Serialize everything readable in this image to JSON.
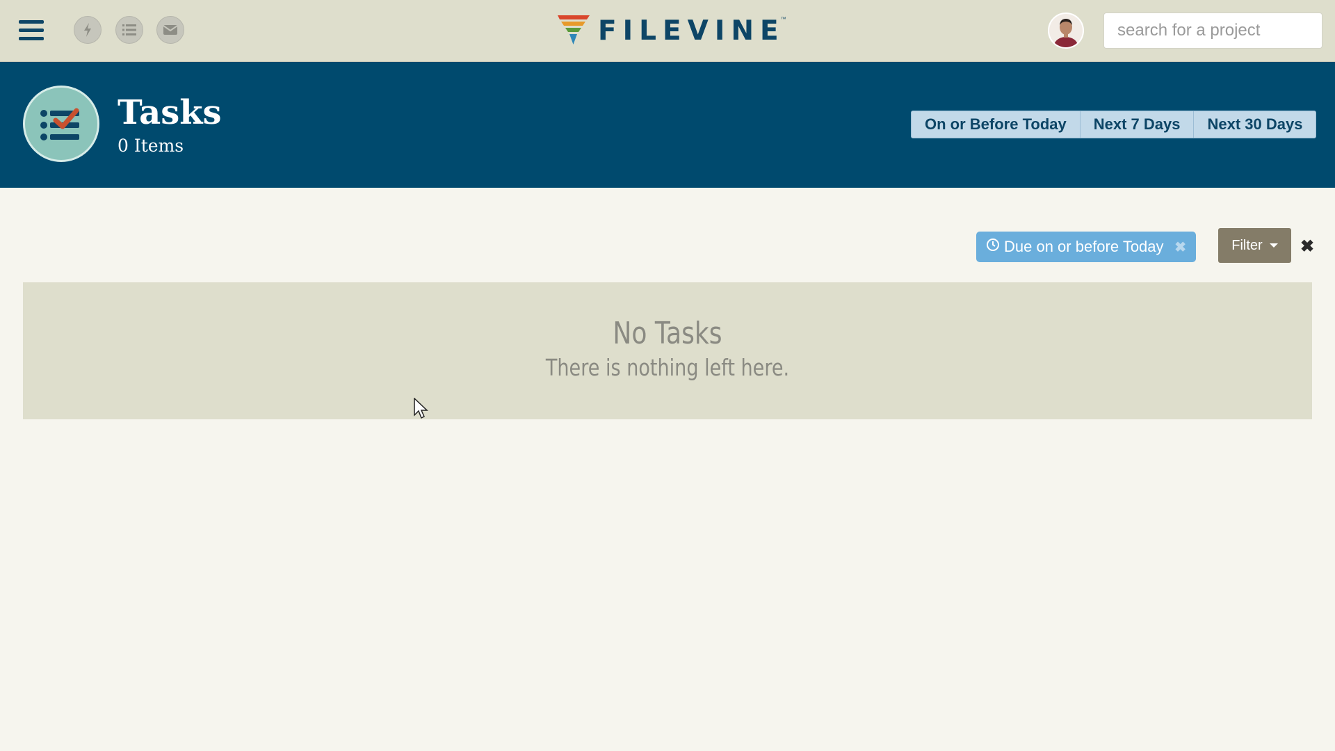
{
  "topbar": {
    "menu_icon": "hamburger-icon",
    "quick_icons": [
      "lightning-icon",
      "list-icon",
      "mail-icon"
    ],
    "brand": "FILEVINE",
    "brand_tm": "™",
    "search": {
      "placeholder": "search for a project",
      "value": ""
    }
  },
  "header": {
    "title": "Tasks",
    "count_label": "0 Items",
    "ranges": [
      "On or Before Today",
      "Next 7 Days",
      "Next 30 Days"
    ]
  },
  "filters": {
    "active_chip": "Due on or before Today",
    "filter_button": "Filter",
    "clear_icon": "close-icon"
  },
  "empty_state": {
    "title": "No Tasks",
    "message": "There is nothing left here."
  },
  "colors": {
    "header_bg": "#004a6e",
    "topbar_bg": "#dedecc",
    "chip_bg": "#6aaedc",
    "filter_bg": "#847c68"
  }
}
